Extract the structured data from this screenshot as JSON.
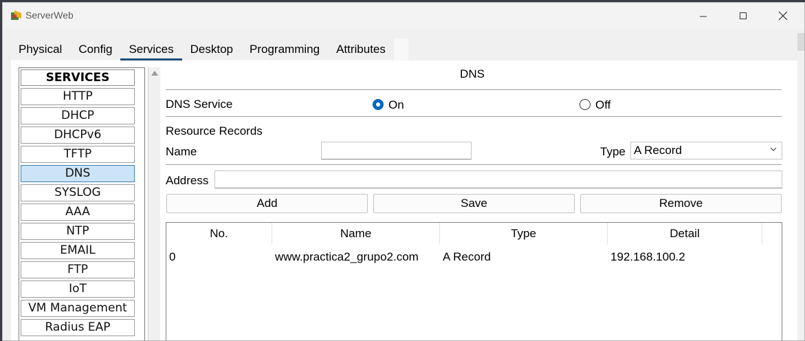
{
  "window": {
    "title": "ServerWeb",
    "controls": [
      "minimize",
      "maximize",
      "close"
    ]
  },
  "tabs": [
    {
      "label": "Physical",
      "active": false
    },
    {
      "label": "Config",
      "active": false
    },
    {
      "label": "Services",
      "active": true
    },
    {
      "label": "Desktop",
      "active": false
    },
    {
      "label": "Programming",
      "active": false
    },
    {
      "label": "Attributes",
      "active": false
    }
  ],
  "services": {
    "header": "SERVICES",
    "items": [
      "HTTP",
      "DHCP",
      "DHCPv6",
      "TFTP",
      "DNS",
      "SYSLOG",
      "AAA",
      "NTP",
      "EMAIL",
      "FTP",
      "IoT",
      "VM Management",
      "Radius EAP"
    ],
    "selected": "DNS"
  },
  "dns": {
    "title": "DNS",
    "service_label": "DNS Service",
    "on_label": "On",
    "off_label": "Off",
    "service_state": "On",
    "resource_records_label": "Resource Records",
    "name_label": "Name",
    "name_value": "",
    "type_label": "Type",
    "type_value": "A Record",
    "address_label": "Address",
    "address_value": "",
    "buttons": {
      "add": "Add",
      "save": "Save",
      "remove": "Remove"
    },
    "table": {
      "columns": [
        "No.",
        "Name",
        "Type",
        "Detail"
      ],
      "rows": [
        {
          "no": "0",
          "name": "www.practica2_grupo2.com",
          "type": "A Record",
          "detail": "192.168.100.2"
        }
      ]
    }
  },
  "colors": {
    "accent": "#0067c0",
    "selected_bg": "#cce4f7",
    "tab_underline": "#1f4e79"
  }
}
